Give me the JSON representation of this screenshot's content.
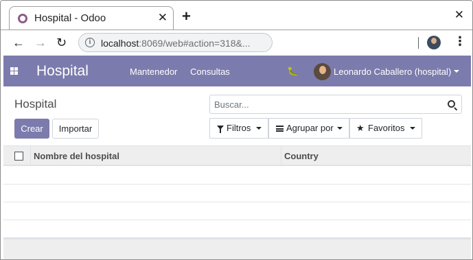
{
  "browser": {
    "tab_title": "Hospital - Odoo",
    "tab_close": "✕",
    "new_tab": "+",
    "window_close": "✕",
    "url_host": "localhost",
    "url_rest": ":8069/web#action=318&...",
    "menu_glyph": "⋮"
  },
  "navbar": {
    "brand": "Hospital",
    "menu": [
      "Mantenedor",
      "Consultas"
    ],
    "user_name": "Leonardo Caballero (hospital)",
    "accent_color": "#7c7bad"
  },
  "control_panel": {
    "breadcrumb": "Hospital",
    "create_label": "Crear",
    "import_label": "Importar",
    "search_placeholder": "Buscar...",
    "filters_label": "Filtros",
    "groupby_label": "Agrupar por",
    "favorites_label": "Favoritos"
  },
  "list": {
    "columns": [
      "Nombre del hospital",
      "Country"
    ],
    "rows": []
  }
}
